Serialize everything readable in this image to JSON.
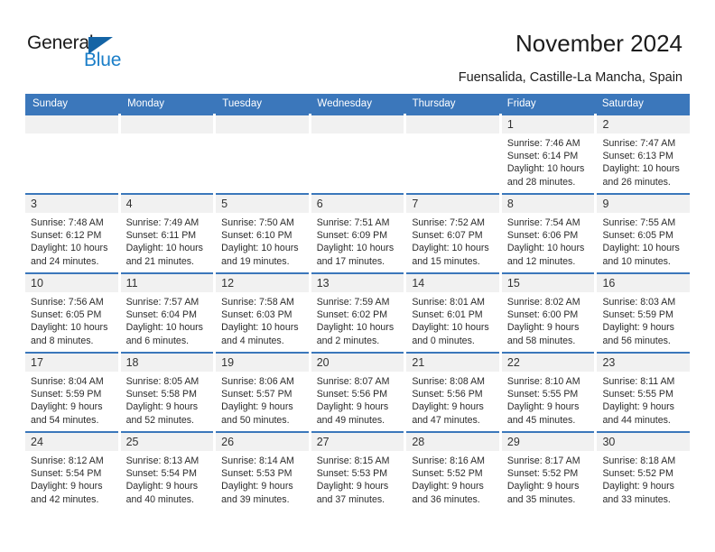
{
  "logo": {
    "word1": "General",
    "word2": "Blue",
    "triangle_color": "#1464a5",
    "blue_color": "#1a7ec8"
  },
  "header": {
    "title": "November 2024",
    "subtitle": "Fuensalida, Castille-La Mancha, Spain"
  },
  "theme": {
    "header_blue": "#3b77bb",
    "daynum_band": "#f1f1f1",
    "text": "#2b2b2b"
  },
  "weekdays": [
    "Sunday",
    "Monday",
    "Tuesday",
    "Wednesday",
    "Thursday",
    "Friday",
    "Saturday"
  ],
  "weeks": [
    [
      {
        "day": "",
        "empty": true
      },
      {
        "day": "",
        "empty": true
      },
      {
        "day": "",
        "empty": true
      },
      {
        "day": "",
        "empty": true
      },
      {
        "day": "",
        "empty": true
      },
      {
        "day": "1",
        "sunrise": "Sunrise: 7:46 AM",
        "sunset": "Sunset: 6:14 PM",
        "daylight1": "Daylight: 10 hours",
        "daylight2": "and 28 minutes."
      },
      {
        "day": "2",
        "sunrise": "Sunrise: 7:47 AM",
        "sunset": "Sunset: 6:13 PM",
        "daylight1": "Daylight: 10 hours",
        "daylight2": "and 26 minutes."
      }
    ],
    [
      {
        "day": "3",
        "sunrise": "Sunrise: 7:48 AM",
        "sunset": "Sunset: 6:12 PM",
        "daylight1": "Daylight: 10 hours",
        "daylight2": "and 24 minutes."
      },
      {
        "day": "4",
        "sunrise": "Sunrise: 7:49 AM",
        "sunset": "Sunset: 6:11 PM",
        "daylight1": "Daylight: 10 hours",
        "daylight2": "and 21 minutes."
      },
      {
        "day": "5",
        "sunrise": "Sunrise: 7:50 AM",
        "sunset": "Sunset: 6:10 PM",
        "daylight1": "Daylight: 10 hours",
        "daylight2": "and 19 minutes."
      },
      {
        "day": "6",
        "sunrise": "Sunrise: 7:51 AM",
        "sunset": "Sunset: 6:09 PM",
        "daylight1": "Daylight: 10 hours",
        "daylight2": "and 17 minutes."
      },
      {
        "day": "7",
        "sunrise": "Sunrise: 7:52 AM",
        "sunset": "Sunset: 6:07 PM",
        "daylight1": "Daylight: 10 hours",
        "daylight2": "and 15 minutes."
      },
      {
        "day": "8",
        "sunrise": "Sunrise: 7:54 AM",
        "sunset": "Sunset: 6:06 PM",
        "daylight1": "Daylight: 10 hours",
        "daylight2": "and 12 minutes."
      },
      {
        "day": "9",
        "sunrise": "Sunrise: 7:55 AM",
        "sunset": "Sunset: 6:05 PM",
        "daylight1": "Daylight: 10 hours",
        "daylight2": "and 10 minutes."
      }
    ],
    [
      {
        "day": "10",
        "sunrise": "Sunrise: 7:56 AM",
        "sunset": "Sunset: 6:05 PM",
        "daylight1": "Daylight: 10 hours",
        "daylight2": "and 8 minutes."
      },
      {
        "day": "11",
        "sunrise": "Sunrise: 7:57 AM",
        "sunset": "Sunset: 6:04 PM",
        "daylight1": "Daylight: 10 hours",
        "daylight2": "and 6 minutes."
      },
      {
        "day": "12",
        "sunrise": "Sunrise: 7:58 AM",
        "sunset": "Sunset: 6:03 PM",
        "daylight1": "Daylight: 10 hours",
        "daylight2": "and 4 minutes."
      },
      {
        "day": "13",
        "sunrise": "Sunrise: 7:59 AM",
        "sunset": "Sunset: 6:02 PM",
        "daylight1": "Daylight: 10 hours",
        "daylight2": "and 2 minutes."
      },
      {
        "day": "14",
        "sunrise": "Sunrise: 8:01 AM",
        "sunset": "Sunset: 6:01 PM",
        "daylight1": "Daylight: 10 hours",
        "daylight2": "and 0 minutes."
      },
      {
        "day": "15",
        "sunrise": "Sunrise: 8:02 AM",
        "sunset": "Sunset: 6:00 PM",
        "daylight1": "Daylight: 9 hours",
        "daylight2": "and 58 minutes."
      },
      {
        "day": "16",
        "sunrise": "Sunrise: 8:03 AM",
        "sunset": "Sunset: 5:59 PM",
        "daylight1": "Daylight: 9 hours",
        "daylight2": "and 56 minutes."
      }
    ],
    [
      {
        "day": "17",
        "sunrise": "Sunrise: 8:04 AM",
        "sunset": "Sunset: 5:59 PM",
        "daylight1": "Daylight: 9 hours",
        "daylight2": "and 54 minutes."
      },
      {
        "day": "18",
        "sunrise": "Sunrise: 8:05 AM",
        "sunset": "Sunset: 5:58 PM",
        "daylight1": "Daylight: 9 hours",
        "daylight2": "and 52 minutes."
      },
      {
        "day": "19",
        "sunrise": "Sunrise: 8:06 AM",
        "sunset": "Sunset: 5:57 PM",
        "daylight1": "Daylight: 9 hours",
        "daylight2": "and 50 minutes."
      },
      {
        "day": "20",
        "sunrise": "Sunrise: 8:07 AM",
        "sunset": "Sunset: 5:56 PM",
        "daylight1": "Daylight: 9 hours",
        "daylight2": "and 49 minutes."
      },
      {
        "day": "21",
        "sunrise": "Sunrise: 8:08 AM",
        "sunset": "Sunset: 5:56 PM",
        "daylight1": "Daylight: 9 hours",
        "daylight2": "and 47 minutes."
      },
      {
        "day": "22",
        "sunrise": "Sunrise: 8:10 AM",
        "sunset": "Sunset: 5:55 PM",
        "daylight1": "Daylight: 9 hours",
        "daylight2": "and 45 minutes."
      },
      {
        "day": "23",
        "sunrise": "Sunrise: 8:11 AM",
        "sunset": "Sunset: 5:55 PM",
        "daylight1": "Daylight: 9 hours",
        "daylight2": "and 44 minutes."
      }
    ],
    [
      {
        "day": "24",
        "sunrise": "Sunrise: 8:12 AM",
        "sunset": "Sunset: 5:54 PM",
        "daylight1": "Daylight: 9 hours",
        "daylight2": "and 42 minutes."
      },
      {
        "day": "25",
        "sunrise": "Sunrise: 8:13 AM",
        "sunset": "Sunset: 5:54 PM",
        "daylight1": "Daylight: 9 hours",
        "daylight2": "and 40 minutes."
      },
      {
        "day": "26",
        "sunrise": "Sunrise: 8:14 AM",
        "sunset": "Sunset: 5:53 PM",
        "daylight1": "Daylight: 9 hours",
        "daylight2": "and 39 minutes."
      },
      {
        "day": "27",
        "sunrise": "Sunrise: 8:15 AM",
        "sunset": "Sunset: 5:53 PM",
        "daylight1": "Daylight: 9 hours",
        "daylight2": "and 37 minutes."
      },
      {
        "day": "28",
        "sunrise": "Sunrise: 8:16 AM",
        "sunset": "Sunset: 5:52 PM",
        "daylight1": "Daylight: 9 hours",
        "daylight2": "and 36 minutes."
      },
      {
        "day": "29",
        "sunrise": "Sunrise: 8:17 AM",
        "sunset": "Sunset: 5:52 PM",
        "daylight1": "Daylight: 9 hours",
        "daylight2": "and 35 minutes."
      },
      {
        "day": "30",
        "sunrise": "Sunrise: 8:18 AM",
        "sunset": "Sunset: 5:52 PM",
        "daylight1": "Daylight: 9 hours",
        "daylight2": "and 33 minutes."
      }
    ]
  ]
}
